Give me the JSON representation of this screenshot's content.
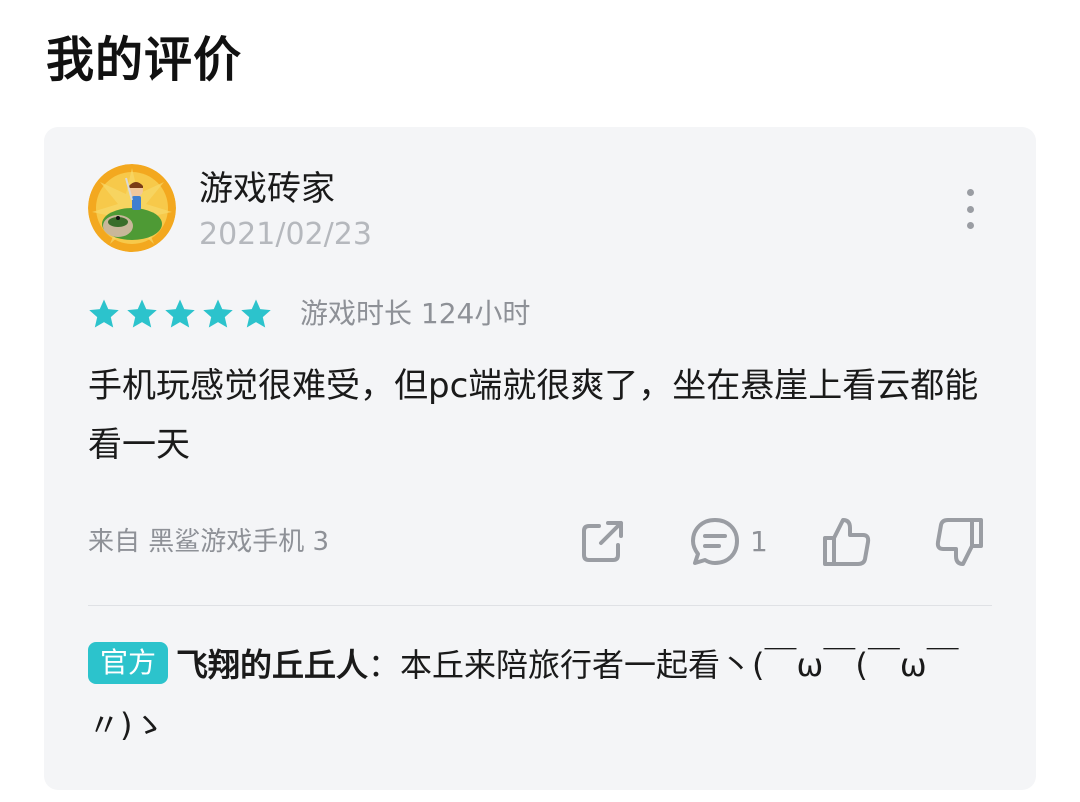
{
  "page": {
    "title": "我的评价"
  },
  "review": {
    "username": "游戏砖家",
    "date": "2021/02/23",
    "rating": 5,
    "rating_max": 5,
    "playtime": "游戏时长 124小时",
    "text": "手机玩感觉很难受，但pc端就很爽了，坐在悬崖上看云都能看一天",
    "device": "来自 黑鲨游戏手机 3",
    "comment_count": "1"
  },
  "reply": {
    "badge": "官方",
    "author": "飞翔的丘丘人",
    "separator": "：",
    "text": "本丘来陪旅行者一起看丶(￣ω￣(￣ω￣〃)ゝ"
  },
  "colors": {
    "accent": "#2cc3cc",
    "icon_gray": "#9a9da3",
    "card_bg": "#f4f5f7"
  },
  "icons": {
    "more": "more-vertical-icon",
    "share": "share-icon",
    "comment": "comment-icon",
    "like": "thumbs-up-icon",
    "dislike": "thumbs-down-icon",
    "star": "star-icon"
  }
}
